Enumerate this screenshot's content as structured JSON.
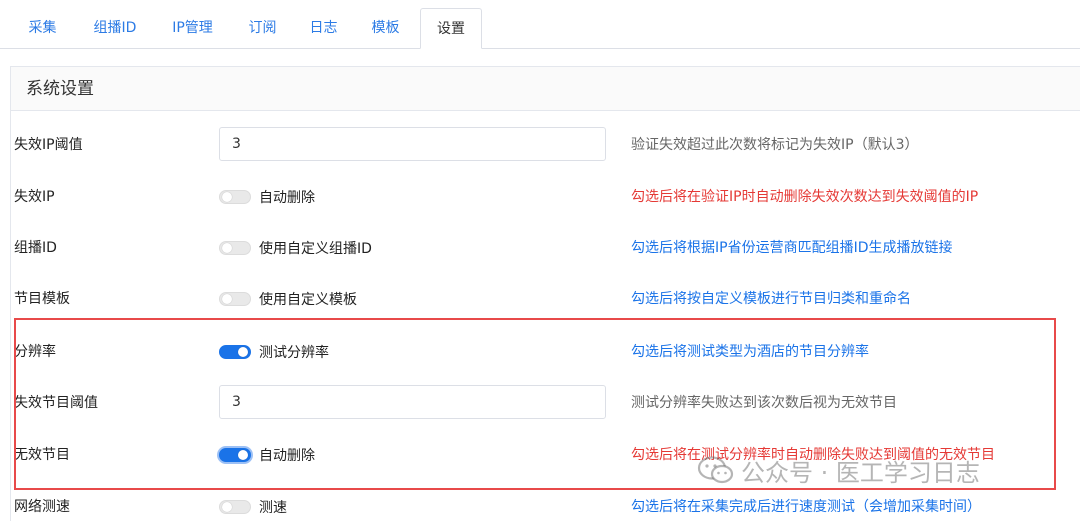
{
  "tabs": [
    {
      "label": "采集"
    },
    {
      "label": "组播ID"
    },
    {
      "label": "IP管理"
    },
    {
      "label": "订阅"
    },
    {
      "label": "日志"
    },
    {
      "label": "模板"
    },
    {
      "label": "设置"
    }
  ],
  "active_tab": "设置",
  "panel": {
    "title": "系统设置"
  },
  "rows": [
    {
      "label": "失效IP阈值",
      "type": "input",
      "value": "3",
      "desc": "验证失效超过此次数将标记为失效IP（默认3）",
      "desc_color": "gray"
    },
    {
      "label": "失效IP",
      "type": "toggle",
      "toggle_label": "自动删除",
      "checked": false,
      "desc": "勾选后将在验证IP时自动删除失效次数达到失效阈值的IP",
      "desc_color": "red"
    },
    {
      "label": "组播ID",
      "type": "toggle",
      "toggle_label": "使用自定义组播ID",
      "checked": false,
      "desc": "勾选后将根据IP省份运营商匹配组播ID生成播放链接",
      "desc_color": "blue"
    },
    {
      "label": "节目模板",
      "type": "toggle",
      "toggle_label": "使用自定义模板",
      "checked": false,
      "desc": "勾选后将按自定义模板进行节目归类和重命名",
      "desc_color": "blue"
    },
    {
      "label": "分辨率",
      "type": "toggle",
      "toggle_label": "测试分辨率",
      "checked": true,
      "desc": "勾选后将测试类型为酒店的节目分辨率",
      "desc_color": "blue"
    },
    {
      "label": "失效节目阈值",
      "type": "input",
      "value": "3",
      "desc": "测试分辨率失败达到该次数后视为无效节目",
      "desc_color": "gray"
    },
    {
      "label": "无效节目",
      "type": "toggle",
      "toggle_label": "自动删除",
      "checked": true,
      "desc": "勾选后将在测试分辨率时自动删除失败达到阈值的无效节目",
      "desc_color": "red"
    },
    {
      "label": "网络测速",
      "type": "toggle",
      "toggle_label": "测速",
      "checked": false,
      "desc": "勾选后将在采集完成后进行速度测试（会增加采集时间）",
      "desc_color": "blue"
    }
  ],
  "watermark": {
    "text": "公众号 · 医工学习日志"
  },
  "colors": {
    "tab_link": "#2c7be5",
    "switch_on": "#1a73e8",
    "desc_red": "#e53935",
    "desc_blue": "#1a73e8",
    "desc_gray": "#666666",
    "highlight_border": "#e84a4a"
  }
}
